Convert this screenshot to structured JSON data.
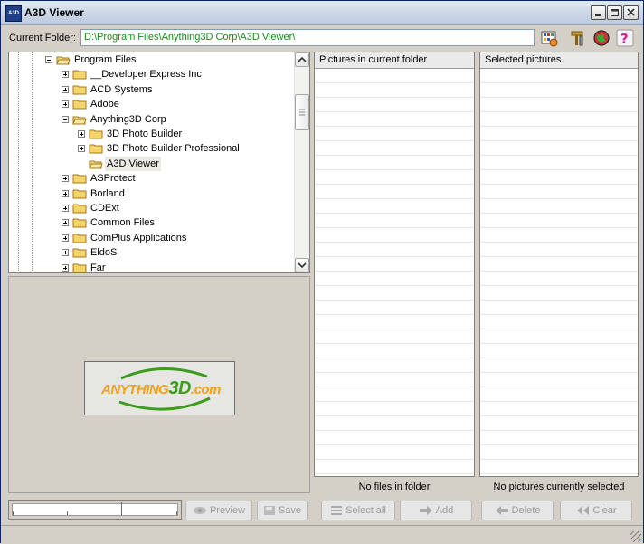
{
  "window": {
    "title": "A3D Viewer",
    "icon_text": "A3D"
  },
  "toolbar": {
    "folder_label": "Current Folder:",
    "folder_path": "D:\\Program Files\\Anything3D Corp\\A3D Viewer\\",
    "tools": [
      "grid-settings-icon",
      "tools-icon",
      "globe-icon",
      "help-icon"
    ]
  },
  "tree": {
    "items": [
      {
        "label": "Program Files",
        "level": 0,
        "expander": "minus",
        "open": true
      },
      {
        "label": "__Developer Express Inc",
        "level": 1,
        "expander": "plus"
      },
      {
        "label": "ACD Systems",
        "level": 1,
        "expander": "plus"
      },
      {
        "label": "Adobe",
        "level": 1,
        "expander": "plus"
      },
      {
        "label": "Anything3D Corp",
        "level": 1,
        "expander": "minus",
        "open": true
      },
      {
        "label": "3D Photo Builder",
        "level": 2,
        "expander": "plus"
      },
      {
        "label": "3D Photo Builder Professional",
        "level": 2,
        "expander": "plus"
      },
      {
        "label": "A3D Viewer",
        "level": 2,
        "expander": "none",
        "selected": true
      },
      {
        "label": "ASProtect",
        "level": 1,
        "expander": "plus"
      },
      {
        "label": "Borland",
        "level": 1,
        "expander": "plus"
      },
      {
        "label": "CDExt",
        "level": 1,
        "expander": "plus"
      },
      {
        "label": "Common Files",
        "level": 1,
        "expander": "plus"
      },
      {
        "label": "ComPlus Applications",
        "level": 1,
        "expander": "plus"
      },
      {
        "label": "EldoS",
        "level": 1,
        "expander": "plus"
      },
      {
        "label": "Far",
        "level": 1,
        "expander": "plus"
      }
    ]
  },
  "logo": {
    "part1": "ANYTHING",
    "part2": "3D",
    "part3": ".com"
  },
  "current_folder_panel": {
    "header": "Pictures in current folder",
    "status": "No files in folder"
  },
  "selected_panel": {
    "header": "Selected pictures",
    "status": "No pictures currently selected"
  },
  "buttons": {
    "preview": "Preview",
    "save": "Save",
    "select_all": "Select all",
    "add": "Add",
    "delete": "Delete",
    "clear": "Clear"
  },
  "colors": {
    "path_text": "#1a8a1a",
    "logo_orange": "#f0a11c",
    "logo_green": "#3e9b1f"
  }
}
